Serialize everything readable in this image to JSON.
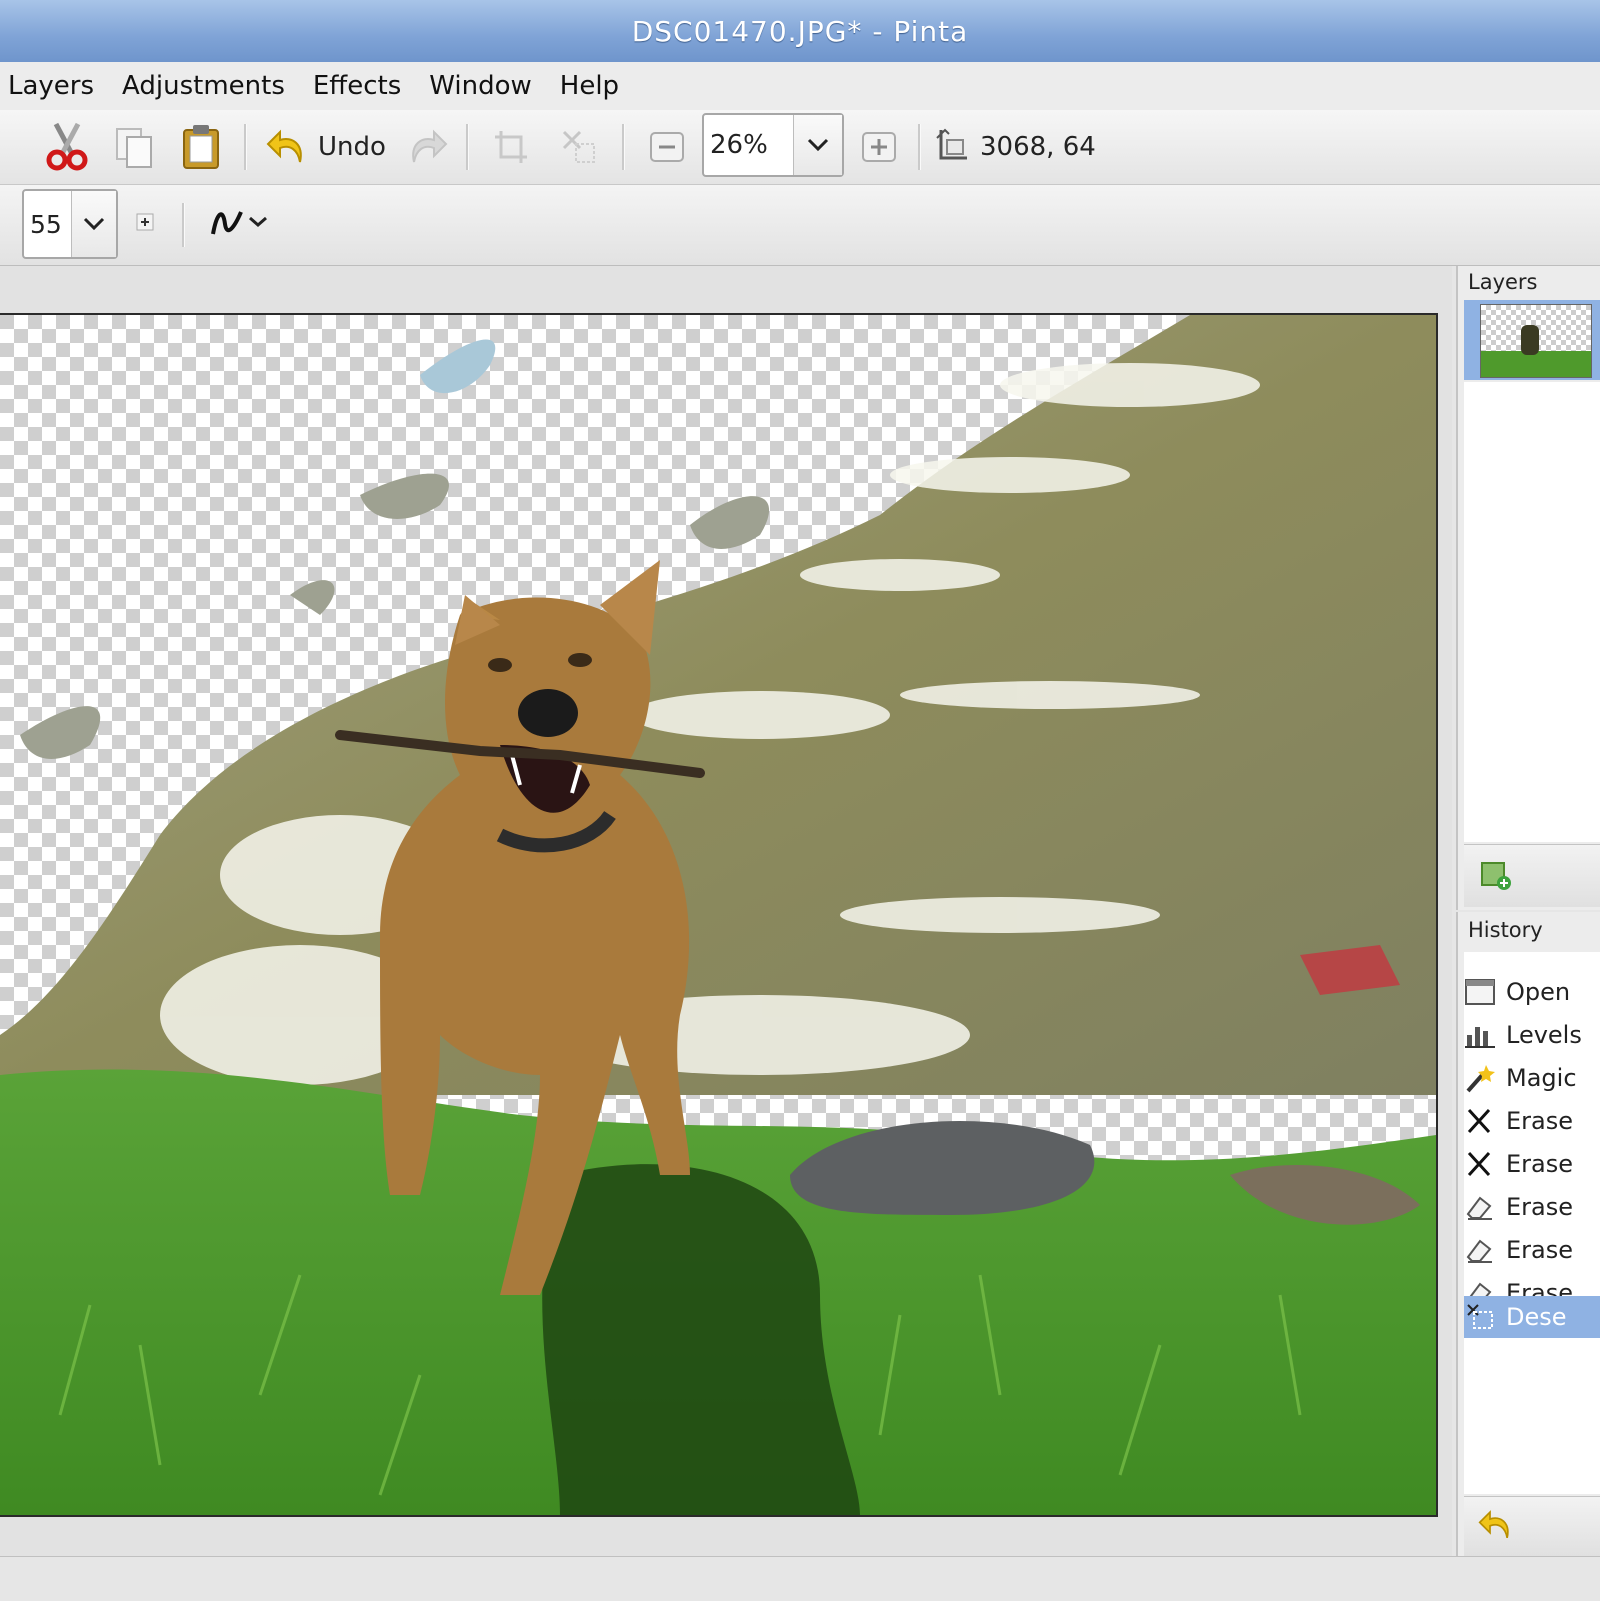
{
  "window": {
    "title": "DSC01470.JPG* - Pinta"
  },
  "menu": [
    {
      "label": "Layers"
    },
    {
      "label": "Adjustments"
    },
    {
      "label": "Effects"
    },
    {
      "label": "Window"
    },
    {
      "label": "Help"
    }
  ],
  "toolbar": {
    "undo_label": "Undo",
    "zoom_value": "26%",
    "cursor_position": "3068, 64"
  },
  "tool_options": {
    "brush_width": "55"
  },
  "layers_panel": {
    "title": "Layers"
  },
  "history_panel": {
    "title": "History",
    "items": [
      {
        "label": "Open",
        "icon": "open-image-icon"
      },
      {
        "label": "Levels",
        "icon": "levels-icon"
      },
      {
        "label": "Magic",
        "icon": "magic-wand-icon"
      },
      {
        "label": "Erase",
        "icon": "erase-selection-icon"
      },
      {
        "label": "Erase",
        "icon": "erase-selection-icon"
      },
      {
        "label": "Erase",
        "icon": "eraser-icon"
      },
      {
        "label": "Erase",
        "icon": "eraser-icon"
      },
      {
        "label": "Erase",
        "icon": "eraser-icon"
      },
      {
        "label": "Dese",
        "icon": "deselect-icon",
        "selected": true
      }
    ]
  },
  "colors": {
    "title_bar": "#7fa3d6",
    "selection": "#8fb2e3",
    "grass": "#4f9a2c",
    "water": "#8b8a5e"
  }
}
